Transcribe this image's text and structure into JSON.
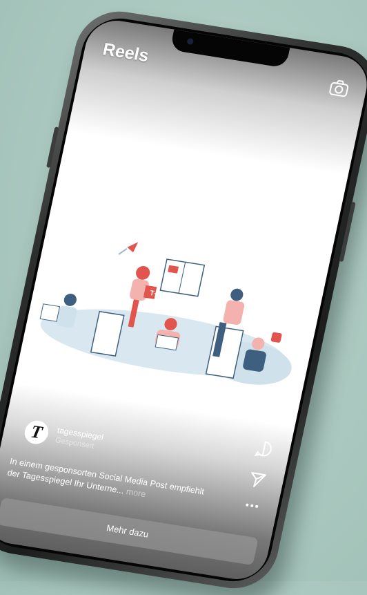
{
  "header": {
    "title": "Reels"
  },
  "post": {
    "avatar_letter": "T",
    "account": "tagesspiegel",
    "sponsored": "Gesponsert",
    "caption": "In einem gesponsorten Social Media Post empfiehlt der Tagesspiegel Ihr Unterne...",
    "more": "more",
    "badge_letter": "T+"
  },
  "cta": {
    "label": "Mehr dazu"
  },
  "icons": [
    "camera-icon",
    "comment-icon",
    "send-icon",
    "more-icon"
  ],
  "colors": {
    "accent_red": "#e2554f",
    "illustration_blue": "#3e5f80",
    "cloud": "#cfe2ec"
  }
}
